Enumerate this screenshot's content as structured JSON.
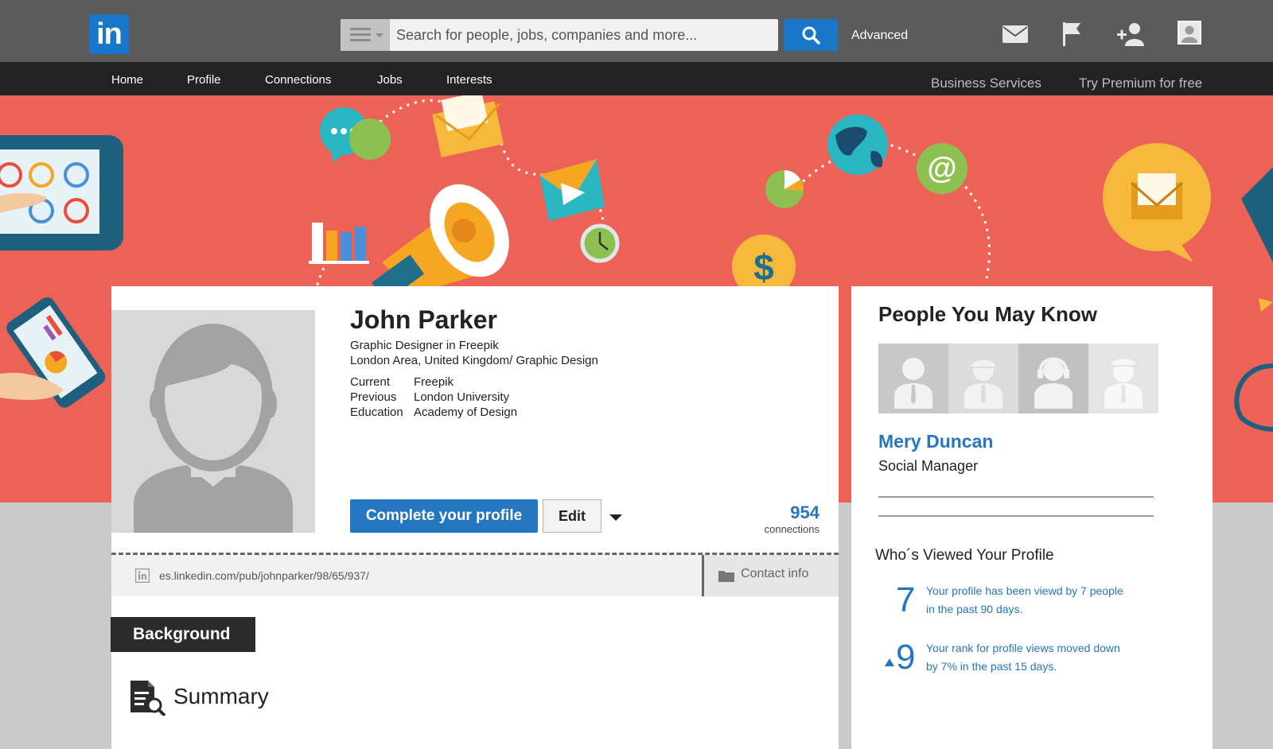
{
  "header": {
    "logo_text": "in",
    "search": {
      "placeholder": "Search for people, jobs, companies and more..."
    },
    "advanced_label": "Advanced",
    "icons": [
      "mail-icon",
      "flag-icon",
      "add-connection-icon",
      "account-avatar-icon"
    ]
  },
  "nav": {
    "items": [
      "Home",
      "Profile",
      "Connections",
      "Jobs",
      "Interests"
    ],
    "business_services": "Business Services",
    "premium": "Try Premium for free"
  },
  "profile": {
    "name": "John Parker",
    "headline": "Graphic Designer in Freepik",
    "location": "London Area, United Kingdom/ Graphic Design",
    "info": [
      {
        "label": "Current",
        "value": "Freepik"
      },
      {
        "label": "Previous",
        "value": "London University"
      },
      {
        "label": "Education",
        "value": "Academy of Design"
      }
    ],
    "complete_button": "Complete your profile",
    "edit_button": "Edit",
    "connections_count": "954",
    "connections_label": "connections",
    "url": "es.linkedin.com/pub/johnparker/98/65/937/",
    "contact_info": "Contact info",
    "background_tab": "Background",
    "summary_title": "Summary"
  },
  "sidebar": {
    "pymk_title": "People You May Know",
    "person": {
      "name": "Mery Duncan",
      "title": "Social Manager"
    },
    "who_viewed_title": "Who´s Viewed Your Profile",
    "stats": [
      {
        "number": "7",
        "text": "Your profile has been viewd by 7 people in the past 90 days."
      },
      {
        "number": "9",
        "text": "Your rank for profile views moved down by 7% in the past 15 days."
      }
    ]
  },
  "colors": {
    "brand_blue": "#2576c0",
    "banner_red": "#ec6256",
    "topbar": "#5b5b5b",
    "navbar": "#232323"
  }
}
